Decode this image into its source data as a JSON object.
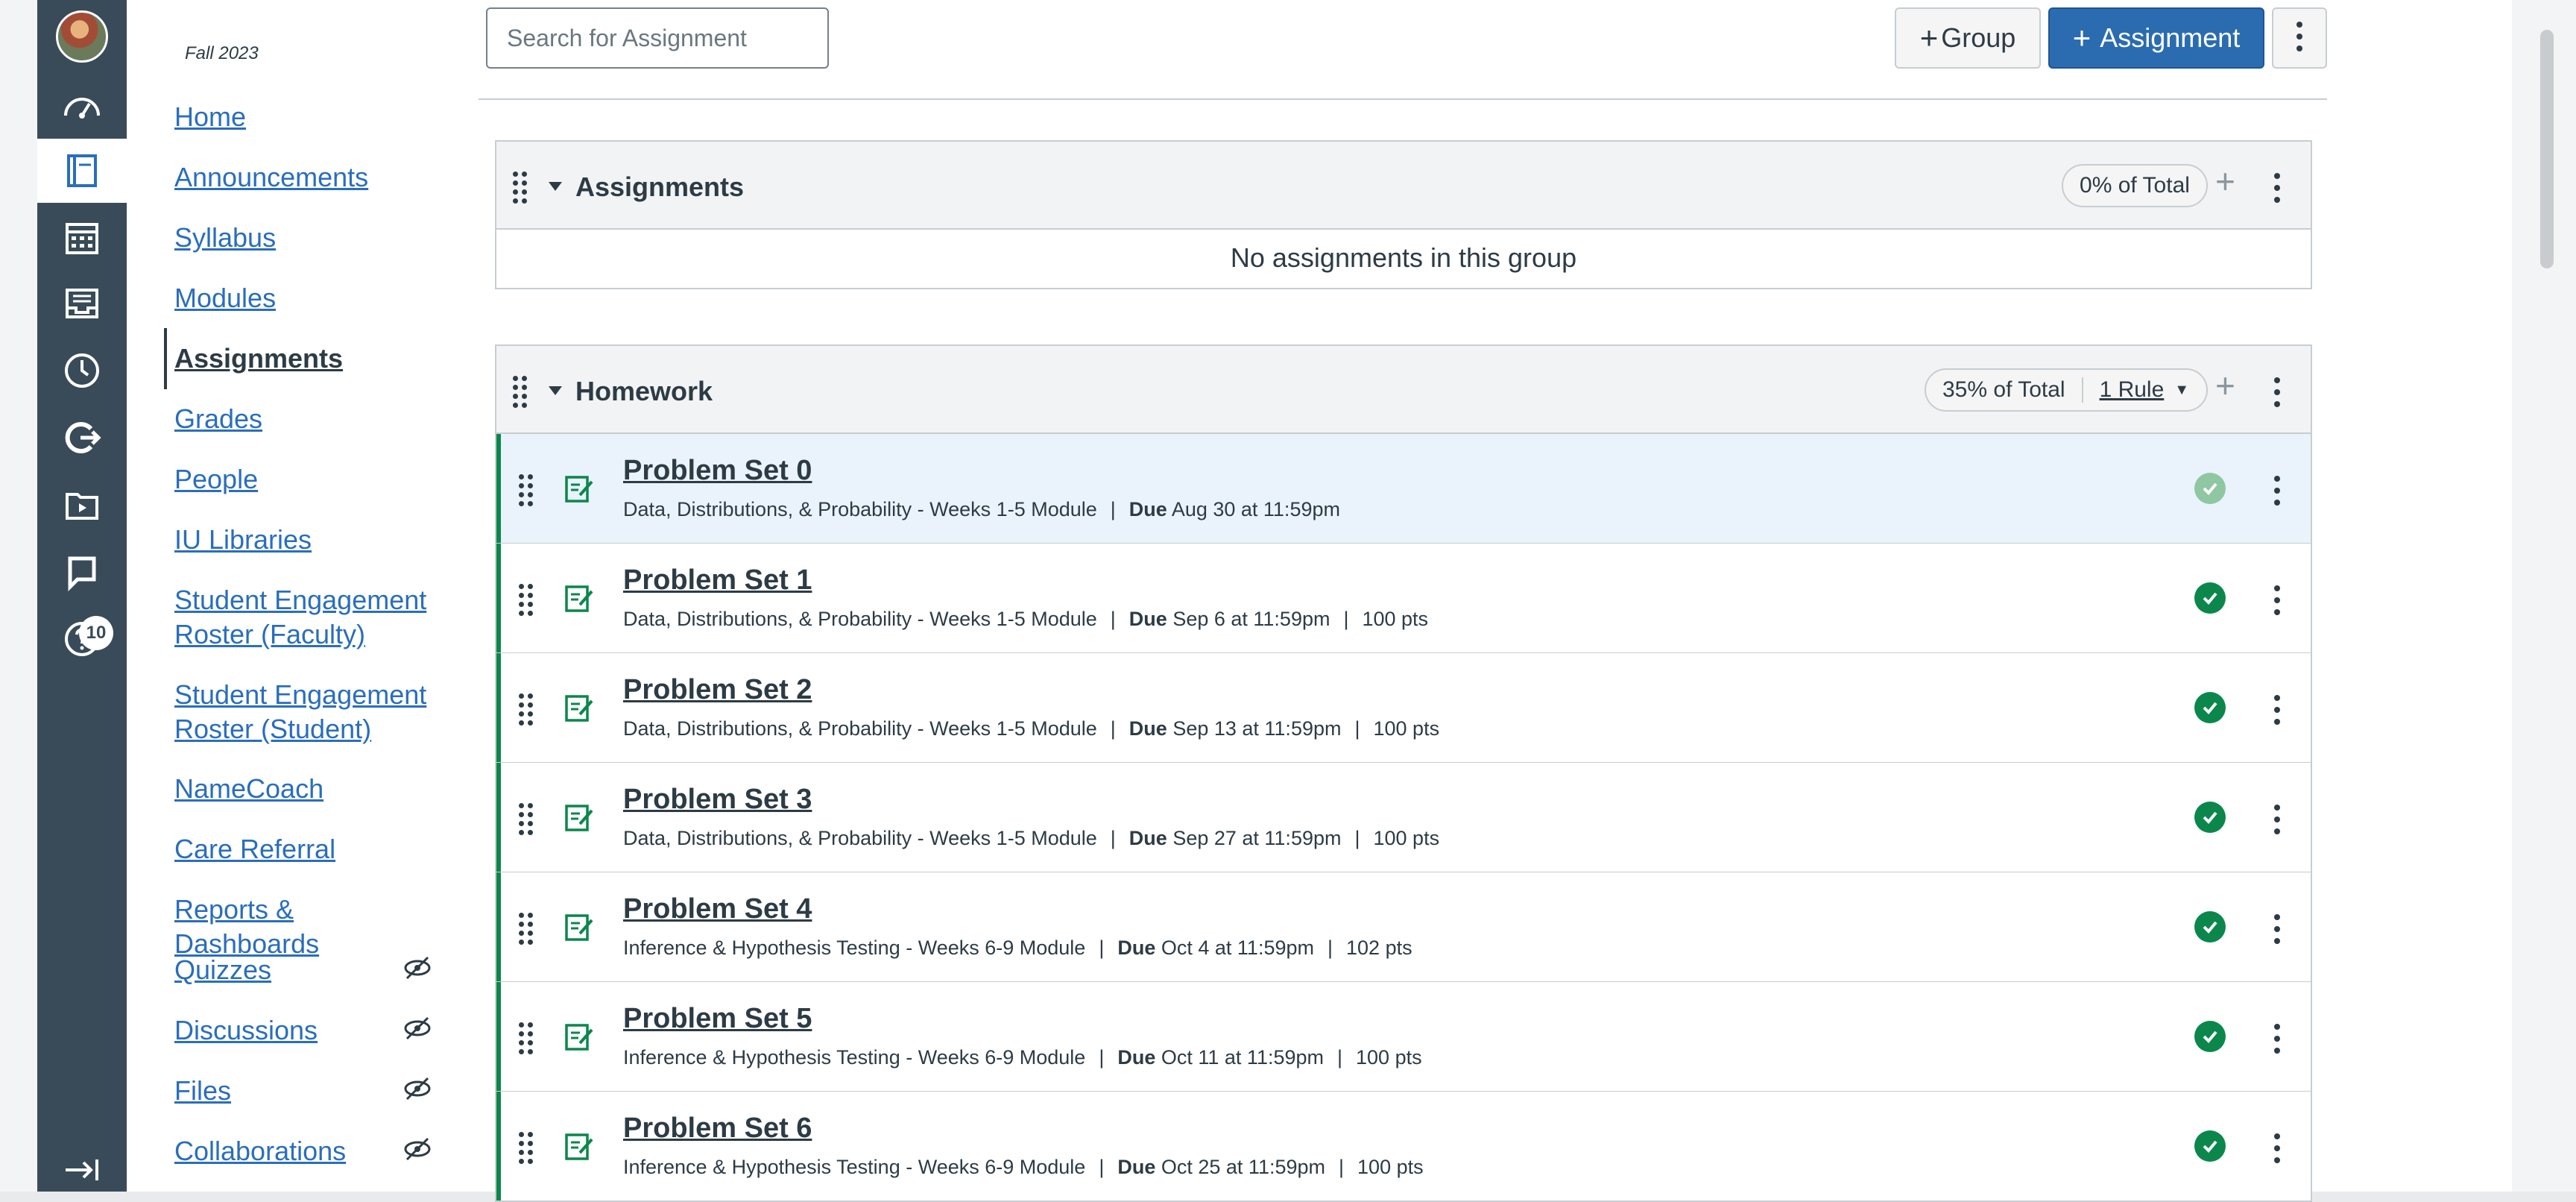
{
  "global_nav": {
    "items": [
      {
        "icon": "avatar",
        "active": false
      },
      {
        "icon": "dashboard-icon",
        "active": false
      },
      {
        "icon": "courses-icon",
        "active": true
      },
      {
        "icon": "calendar-icon",
        "active": false
      },
      {
        "icon": "inbox-icon",
        "active": false
      },
      {
        "icon": "history-icon",
        "active": false
      },
      {
        "icon": "commons-icon",
        "active": false
      },
      {
        "icon": "studio-icon",
        "active": false
      },
      {
        "icon": "feedback-icon",
        "active": false
      },
      {
        "icon": "help-icon",
        "active": false
      }
    ],
    "help_badge": "10",
    "collapse_icon": "collapse-icon"
  },
  "course_nav": {
    "term": "Fall 2023",
    "links": [
      {
        "label": "Home",
        "active": false,
        "hidden": false
      },
      {
        "label": "Announcements",
        "active": false,
        "hidden": false
      },
      {
        "label": "Syllabus",
        "active": false,
        "hidden": false
      },
      {
        "label": "Modules",
        "active": false,
        "hidden": false
      },
      {
        "label": "Assignments",
        "active": true,
        "hidden": false
      },
      {
        "label": "Grades",
        "active": false,
        "hidden": false
      },
      {
        "label": "People",
        "active": false,
        "hidden": false
      },
      {
        "label": "IU Libraries",
        "active": false,
        "hidden": false
      },
      {
        "label": "Student Engagement Roster (Faculty)",
        "active": false,
        "hidden": false
      },
      {
        "label": "Student Engagement Roster (Student)",
        "active": false,
        "hidden": false
      },
      {
        "label": "NameCoach",
        "active": false,
        "hidden": false
      },
      {
        "label": "Care Referral",
        "active": false,
        "hidden": false
      },
      {
        "label": "Reports & Dashboards",
        "active": false,
        "hidden": false
      },
      {
        "label": "Quizzes",
        "active": false,
        "hidden": true
      },
      {
        "label": "Discussions",
        "active": false,
        "hidden": true
      },
      {
        "label": "Files",
        "active": false,
        "hidden": true
      },
      {
        "label": "Collaborations",
        "active": false,
        "hidden": true
      }
    ]
  },
  "toolbar": {
    "search_placeholder": "Search for Assignment",
    "group_label": "Group",
    "assignment_label": "Assignment"
  },
  "groups": [
    {
      "title": "Assignments",
      "weight": "0% of Total",
      "rules": "",
      "empty_text": "No assignments in this group",
      "items": []
    },
    {
      "title": "Homework",
      "weight": "35% of Total",
      "rules": "1 Rule",
      "empty_text": "",
      "items": [
        {
          "title": "Problem Set 0",
          "module": "Data, Distributions, & Probability - Weeks 1-5 Module",
          "due_label": "Due",
          "due": "Aug 30 at 11:59pm",
          "pts": "",
          "published": true,
          "highlight": true
        },
        {
          "title": "Problem Set 1",
          "module": "Data, Distributions, & Probability - Weeks 1-5 Module",
          "due_label": "Due",
          "due": "Sep 6 at 11:59pm",
          "pts": "100 pts",
          "published": true,
          "highlight": false
        },
        {
          "title": "Problem Set 2",
          "module": "Data, Distributions, & Probability - Weeks 1-5 Module",
          "due_label": "Due",
          "due": "Sep 13 at 11:59pm",
          "pts": "100 pts",
          "published": true,
          "highlight": false
        },
        {
          "title": "Problem Set 3",
          "module": "Data, Distributions, & Probability - Weeks 1-5 Module",
          "due_label": "Due",
          "due": "Sep 27 at 11:59pm",
          "pts": "100 pts",
          "published": true,
          "highlight": false
        },
        {
          "title": "Problem Set 4",
          "module": "Inference & Hypothesis Testing - Weeks 6-9 Module",
          "due_label": "Due",
          "due": "Oct 4 at 11:59pm",
          "pts": "102 pts",
          "published": true,
          "highlight": false
        },
        {
          "title": "Problem Set 5",
          "module": "Inference & Hypothesis Testing - Weeks 6-9 Module",
          "due_label": "Due",
          "due": "Oct 11 at 11:59pm",
          "pts": "100 pts",
          "published": true,
          "highlight": false
        },
        {
          "title": "Problem Set 6",
          "module": "Inference & Hypothesis Testing - Weeks 6-9 Module",
          "due_label": "Due",
          "due": "Oct 25 at 11:59pm",
          "pts": "100 pts",
          "published": true,
          "highlight": false
        }
      ]
    }
  ],
  "colors": {
    "nav_bg": "#394b58",
    "link": "#2a6ebc",
    "primary_button": "#2b6cb0",
    "published_green": "#0b874b"
  }
}
